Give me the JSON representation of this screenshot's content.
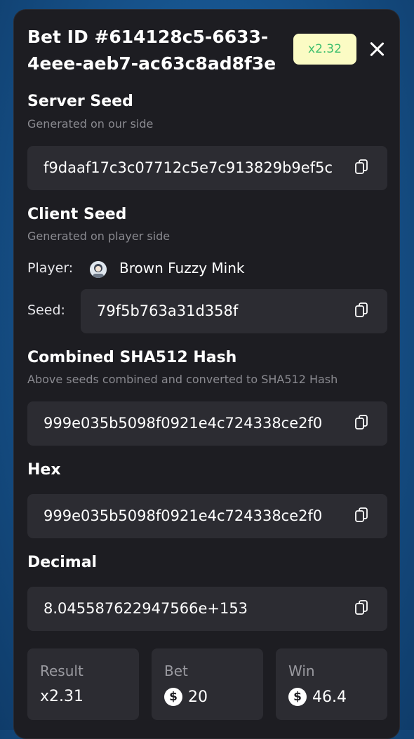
{
  "header": {
    "title": "Bet ID #614128c5-6633-4eee-aeb7-ac63c8ad8f3e",
    "multiplier_badge": "x2.32"
  },
  "server_seed": {
    "title": "Server Seed",
    "subtitle": "Generated on our side",
    "value": "f9daaf17c3c07712c5e7c913829b9ef5c"
  },
  "client_seed": {
    "title": "Client Seed",
    "subtitle": "Generated on player side",
    "player_label": "Player:",
    "player_name": "Brown Fuzzy Mink",
    "seed_label": "Seed:",
    "seed_value": "79f5b763a31d358f"
  },
  "combined_hash": {
    "title": "Combined SHA512 Hash",
    "subtitle": "Above seeds combined and converted to SHA512 Hash",
    "value": "999e035b5098f0921e4c724338ce2f0"
  },
  "hex": {
    "title": "Hex",
    "value": "999e035b5098f0921e4c724338ce2f0"
  },
  "decimal": {
    "title": "Decimal",
    "value": "8.045587622947566e+153"
  },
  "stats": {
    "result_label": "Result",
    "result_value": "x2.31",
    "bet_label": "Bet",
    "bet_value": "20",
    "win_label": "Win",
    "win_value": "46.4",
    "currency_symbol": "$"
  },
  "icons": {
    "close": "close-icon",
    "copy": "copy-icon",
    "avatar": "avatar-icon",
    "coin": "dollar-coin-icon"
  },
  "colors": {
    "badge_bg": "#fbfbc4",
    "badge_text": "#3fbf6e",
    "modal_bg": "#1d1d22",
    "field_bg": "#2c2c32"
  }
}
